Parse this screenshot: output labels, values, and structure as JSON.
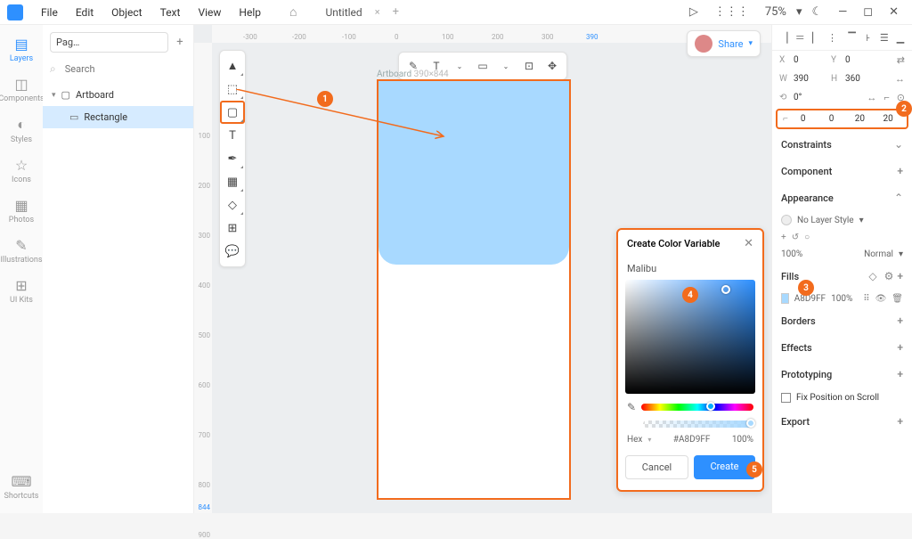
{
  "menubar": {
    "items": [
      "File",
      "Edit",
      "Object",
      "Text",
      "View",
      "Help"
    ],
    "doc_title": "Untitled",
    "home_icon": "⌂",
    "close_icon": "×",
    "add_icon": "+",
    "play_icon": "▷",
    "grid_icon": "⋮⋮⋮",
    "zoom": "75%",
    "zoom_caret": "▾",
    "theme_icon": "☾",
    "min_icon": "—",
    "max_icon": "◻",
    "close_win": "✕"
  },
  "leftrail": {
    "items": [
      {
        "icon": "▤",
        "label": "Layers",
        "active": true
      },
      {
        "icon": "◫",
        "label": "Components"
      },
      {
        "icon": "◐",
        "label": "Styles"
      },
      {
        "icon": "☆",
        "label": "Icons"
      },
      {
        "icon": "▦",
        "label": "Photos"
      },
      {
        "icon": "✎",
        "label": "Illustrations"
      },
      {
        "icon": "⊞",
        "label": "UI Kits"
      }
    ],
    "shortcuts": {
      "icon": "⌨",
      "label": "Shortcuts"
    }
  },
  "layers": {
    "page_select": "Pag…",
    "page_add": "+",
    "search_placeholder": "Search",
    "search_icon": "⌕",
    "target_icon": "⦿",
    "collapse_icon": "⌄",
    "tree": {
      "artboard": {
        "caret": "▾",
        "icon": "▢",
        "label": "Artboard"
      },
      "rectangle": {
        "icon": "▭",
        "label": "Rectangle"
      }
    }
  },
  "ruler_h": [
    "-300",
    "-200",
    "-100",
    "0",
    "100",
    "200",
    "300",
    "390"
  ],
  "ruler_v": [
    "100",
    "200",
    "300",
    "400",
    "500",
    "600",
    "700",
    "800",
    "844",
    "900"
  ],
  "toolstrip": [
    {
      "glyph": "▲"
    },
    {
      "glyph": "⬚"
    },
    {
      "glyph": "▢",
      "selected": true
    },
    {
      "glyph": "T"
    },
    {
      "glyph": "✒"
    },
    {
      "glyph": "▦"
    },
    {
      "glyph": "◇"
    },
    {
      "glyph": "⊞"
    },
    {
      "glyph": "💬"
    }
  ],
  "top_toolbar": [
    "✎",
    "T",
    "⌄",
    "▭",
    "⌄",
    "⊡",
    "✥"
  ],
  "share": {
    "text": "Share",
    "caret": "▾"
  },
  "artboard": {
    "label": "Artboard",
    "dims": "390×844"
  },
  "right": {
    "align_icons": [
      "▕",
      "＝",
      "▏",
      "⋮",
      "▔",
      "꜔",
      "☰",
      "▁"
    ],
    "x_label": "X",
    "x_val": "0",
    "y_label": "Y",
    "y_val": "0",
    "w_label": "W",
    "w_val": "390",
    "h_label": "H",
    "h_val": "360",
    "link_icon": "⇄",
    "rot_label": "⟲",
    "rot_val": "0°",
    "flip_icon": "↔",
    "bracket1": "⌐",
    "bracket2": "⊙",
    "radius_icon": "⌐",
    "radius": [
      "0",
      "0",
      "20",
      "20"
    ],
    "constraints": {
      "label": "Constraints",
      "toggle": "⌄"
    },
    "component": {
      "label": "Component",
      "toggle": "+"
    },
    "appearance": {
      "label": "Appearance",
      "toggle": "⌃"
    },
    "layer_style": {
      "text": "No Layer Style",
      "caret": "▾",
      "plus": "+",
      "reset1": "↺",
      "reset2": "○"
    },
    "opacity": {
      "val": "100%",
      "blend": "Normal",
      "caret": "▾"
    },
    "fills": {
      "label": "Fills",
      "drop": "◇",
      "adjust": "⚙",
      "plus": "+",
      "hex": "A8D9FF",
      "pct": "100%",
      "drag": "⠿",
      "eye": "👁",
      "del": "🗑"
    },
    "borders": {
      "label": "Borders",
      "toggle": "+"
    },
    "effects": {
      "label": "Effects",
      "toggle": "+"
    },
    "prototyping": {
      "label": "Prototyping",
      "toggle": "+"
    },
    "fix_scroll": {
      "label": "Fix Position on Scroll"
    },
    "export": {
      "label": "Export",
      "toggle": "+"
    }
  },
  "color_popup": {
    "title": "Create Color Variable",
    "close": "✕",
    "name": "Malibu",
    "eyedrop": "✎",
    "hex_label": "Hex",
    "hex_caret": "▾",
    "hex_val": "#A8D9FF",
    "hex_alpha": "100%",
    "cancel": "Cancel",
    "create": "Create"
  },
  "badges": {
    "b1": "1",
    "b2": "2",
    "b3": "3",
    "b4": "4",
    "b5": "5"
  }
}
